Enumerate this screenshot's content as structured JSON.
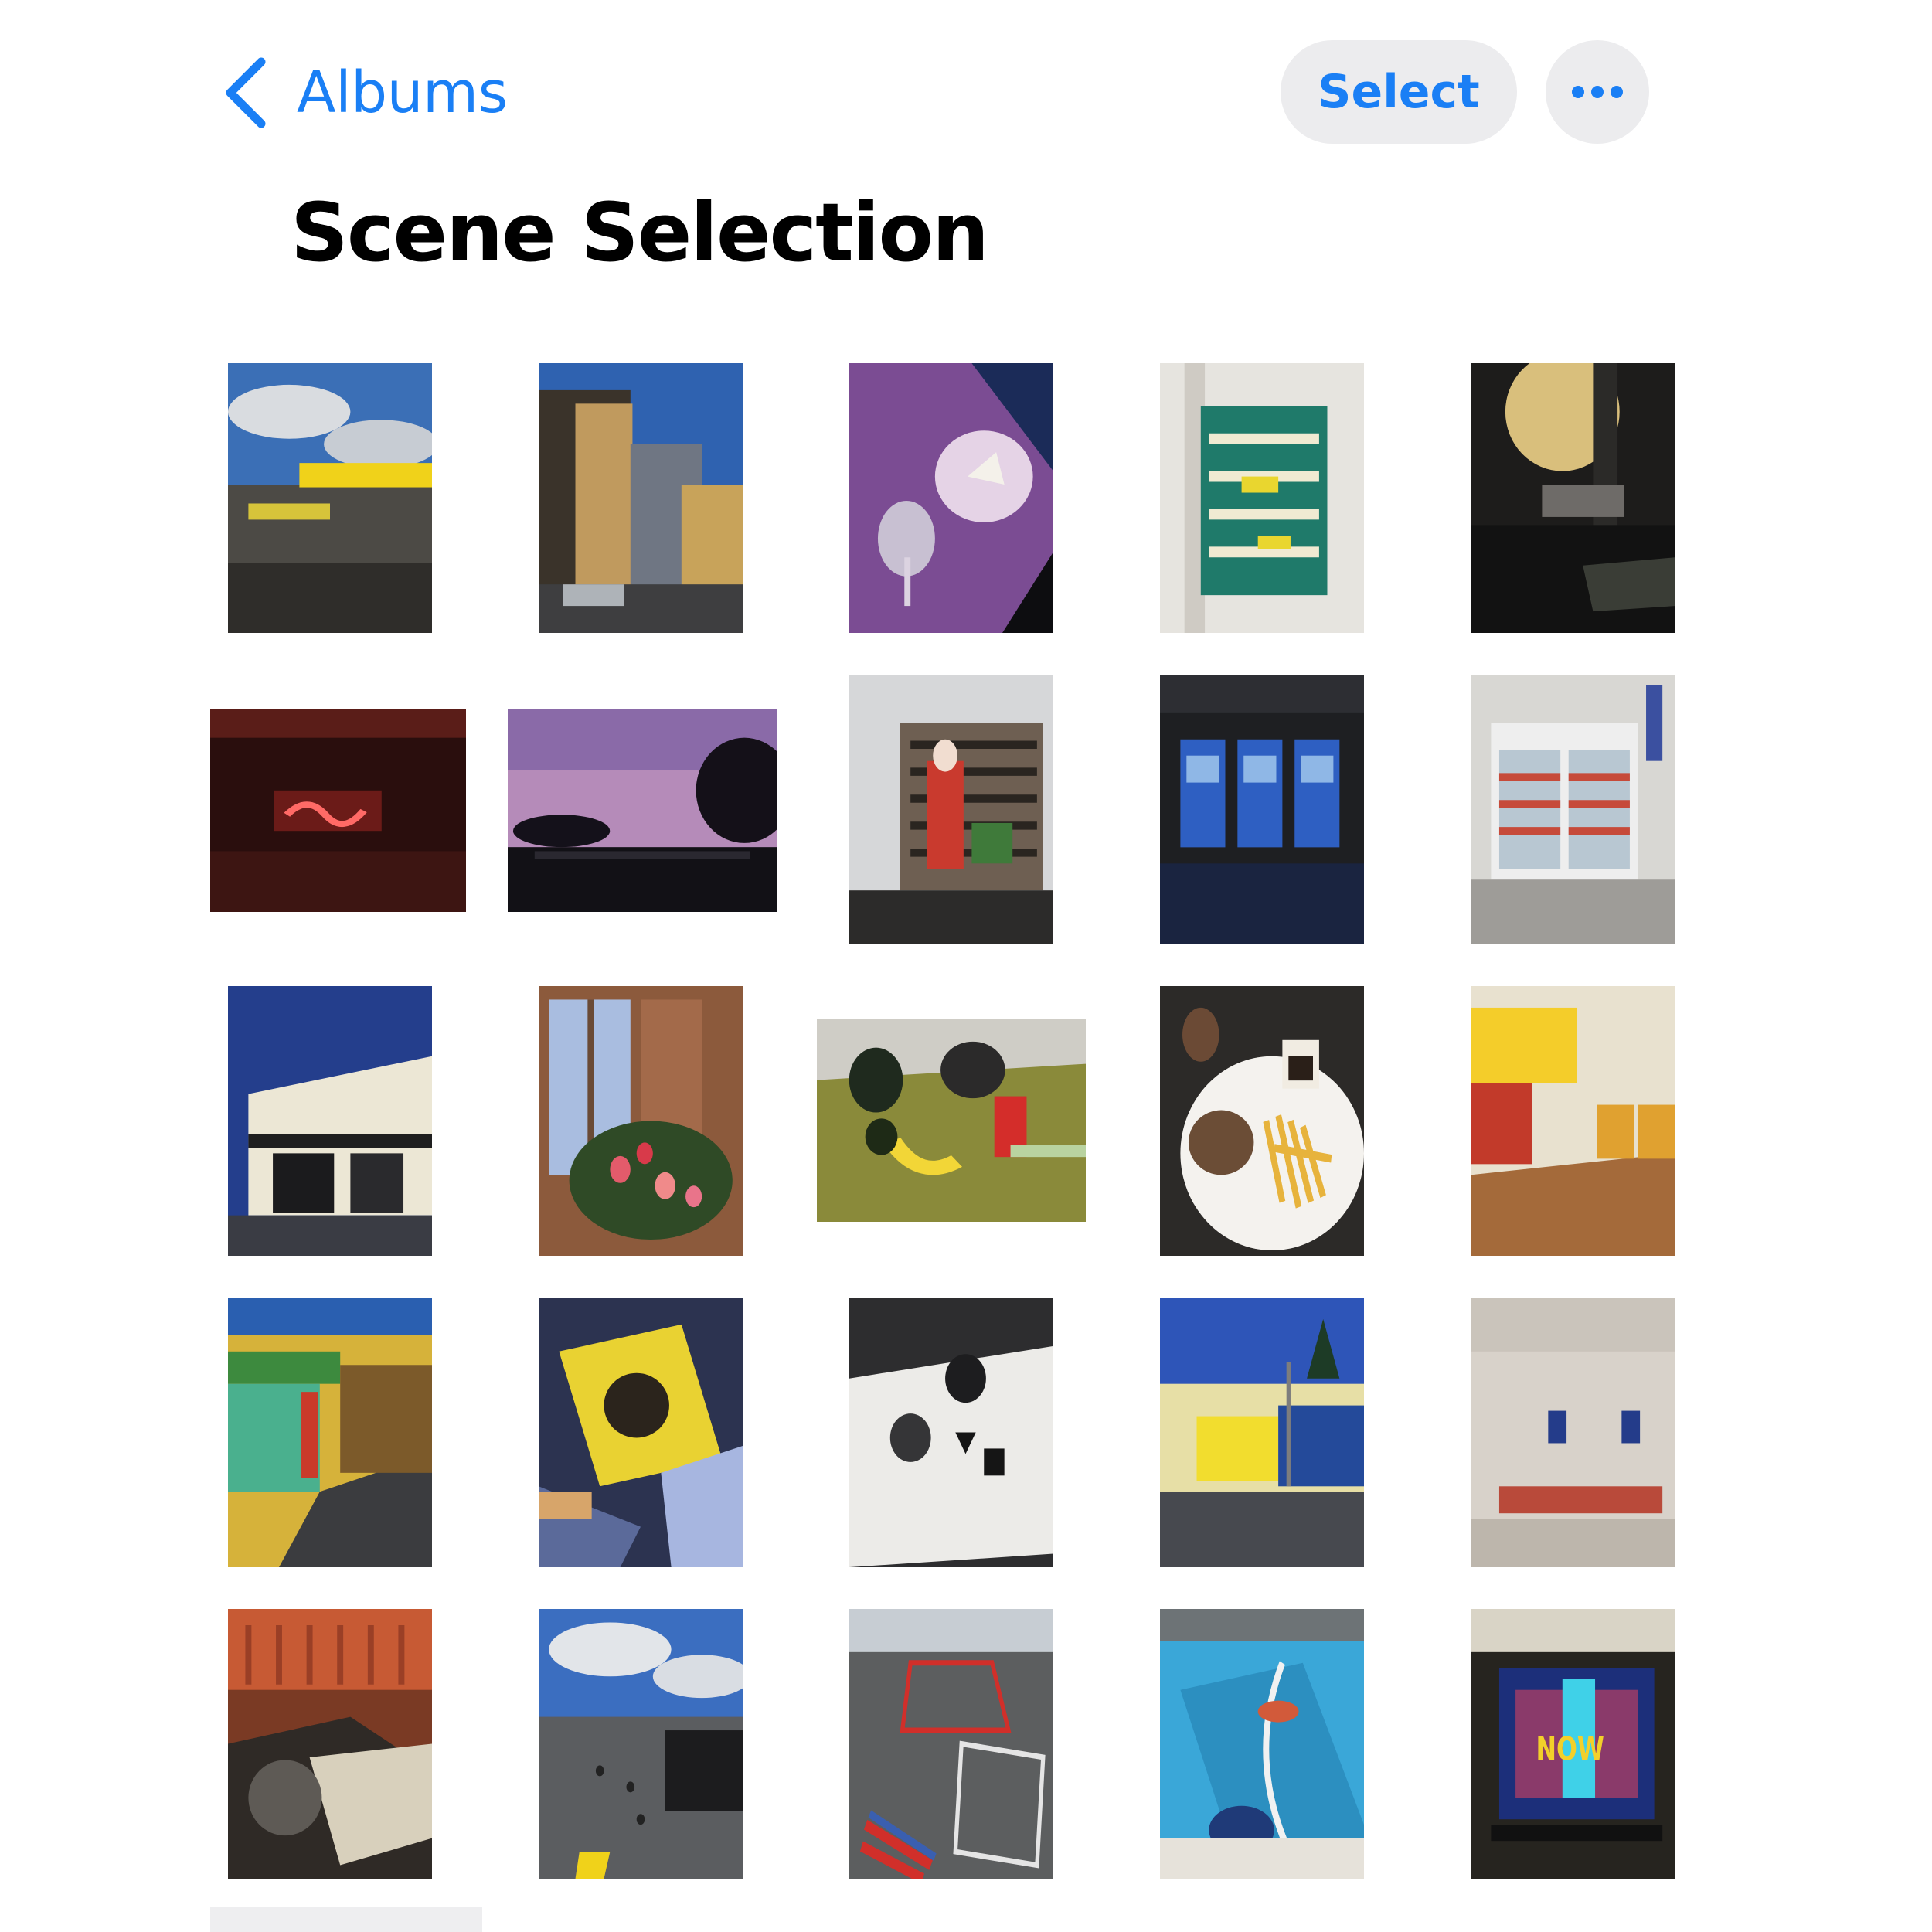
{
  "nav": {
    "back_label": "Albums",
    "back_icon": "chevron-left-icon",
    "select_label": "Select",
    "more_icon": "ellipsis-icon",
    "accent_color": "#1a7ff5"
  },
  "album": {
    "title": "Scene Selection"
  },
  "photo_grid": {
    "columns": 5,
    "rows": 5,
    "photo_count": 25
  }
}
